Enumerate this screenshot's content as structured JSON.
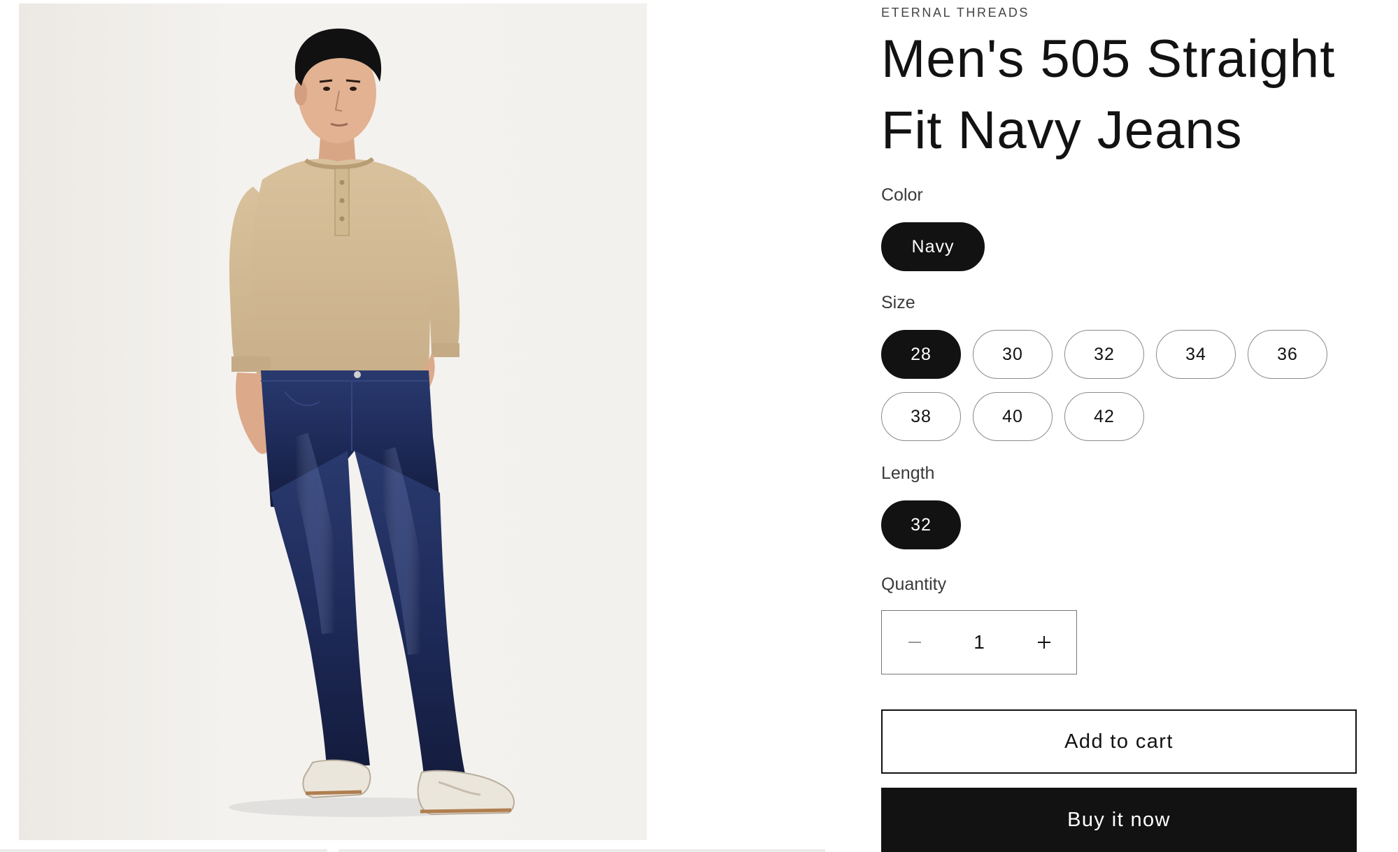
{
  "product": {
    "vendor": "ETERNAL THREADS",
    "title": "Men's 505 Straight Fit Navy Jeans"
  },
  "options": {
    "color": {
      "label": "Color",
      "values": [
        "Navy"
      ],
      "selected": "Navy"
    },
    "size": {
      "label": "Size",
      "values": [
        "28",
        "30",
        "32",
        "34",
        "36",
        "38",
        "40",
        "42"
      ],
      "selected": "28"
    },
    "length": {
      "label": "Length",
      "values": [
        "32"
      ],
      "selected": "32"
    }
  },
  "quantity": {
    "label": "Quantity",
    "value": "1",
    "decrease_icon": "minus-icon",
    "increase_icon": "plus-icon"
  },
  "actions": {
    "add_to_cart": "Add to cart",
    "buy_now": "Buy it now"
  },
  "colors": {
    "primary": "#121212",
    "background": "#ffffff",
    "pill_border": "#8a8a8a",
    "image_background": "#f3f1ee"
  }
}
